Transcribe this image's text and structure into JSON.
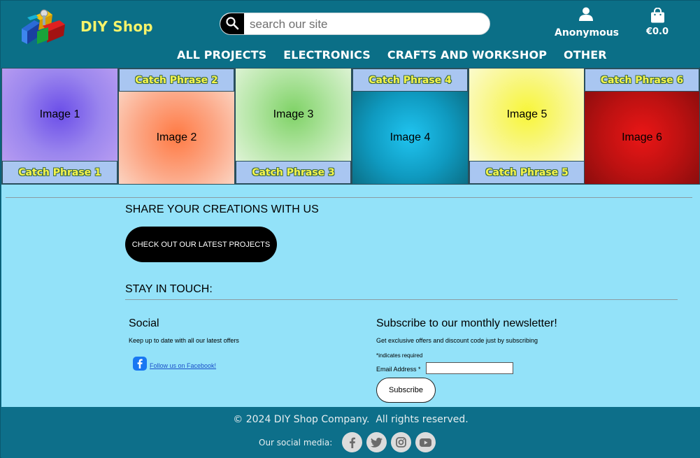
{
  "brand": {
    "name": "DIY Shop",
    "logo_icon": "diy-shop-logo-icon"
  },
  "search": {
    "placeholder": "search our site",
    "icon": "search-icon"
  },
  "account": {
    "label": "Anonymous",
    "icon": "user-icon"
  },
  "cart": {
    "label": "€0.0",
    "icon": "shopping-bag-icon"
  },
  "nav": {
    "items": [
      {
        "label": "ALL PROJECTS"
      },
      {
        "label": "ELECTRONICS"
      },
      {
        "label": "CRAFTS AND WORKSHOP"
      },
      {
        "label": "OTHER"
      }
    ]
  },
  "gallery": {
    "tiles": [
      {
        "image_label": "Image 1",
        "phrase": "Catch Phrase 1",
        "color_center": "#6b4ee8",
        "color_edge": "#b79cf1"
      },
      {
        "image_label": "Image 2",
        "phrase": "Catch Phrase 2",
        "color_center": "#ff7a44",
        "color_edge": "#fbd4c2"
      },
      {
        "image_label": "Image 3",
        "phrase": "Catch Phrase 3",
        "color_center": "#7fd266",
        "color_edge": "#dff3d6"
      },
      {
        "image_label": "Image 4",
        "phrase": "Catch Phrase 4",
        "color_center": "#20c4f0",
        "color_edge": "#0b6f86"
      },
      {
        "image_label": "Image 5",
        "phrase": "Catch Phrase 5",
        "color_center": "#f7f538",
        "color_edge": "#fbfbd2"
      },
      {
        "image_label": "Image 6",
        "phrase": "Catch Phrase 6",
        "color_center": "#ea1616",
        "color_edge": "#8b0d0d"
      }
    ],
    "phrase_bg": "#a9c6f1",
    "phrase_text": "#f7f54a"
  },
  "main": {
    "share_title": "SHARE YOUR CREATIONS WITH US",
    "cta_label": "CHECK OUT OUR LATEST PROJECTS",
    "stay_title": "STAY IN TOUCH:",
    "social": {
      "heading": "Social",
      "text": "Keep up to date with all our latest offers",
      "facebook_link": "Follow us on Facebook!"
    },
    "newsletter": {
      "heading": "Subscribe to our monthly newsletter!",
      "text": "Get exclusive offers and discount code just by subscribing",
      "required_note": "*indicates required",
      "email_label": "Email Address *",
      "email_value": "",
      "subscribe_label": "Subscribe"
    },
    "bg_color": "#93e2f9"
  },
  "footer": {
    "copyright": "© 2024 DIY Shop Company.  All rights reserved.",
    "social_label": "Our social media:",
    "icons": [
      "facebook-icon",
      "twitter-icon",
      "instagram-icon",
      "youtube-icon"
    ]
  },
  "colors": {
    "header_bg": "#0b6f87",
    "brand_yellow": "#f6f36a",
    "footer_bg": "#0d6f8a"
  }
}
